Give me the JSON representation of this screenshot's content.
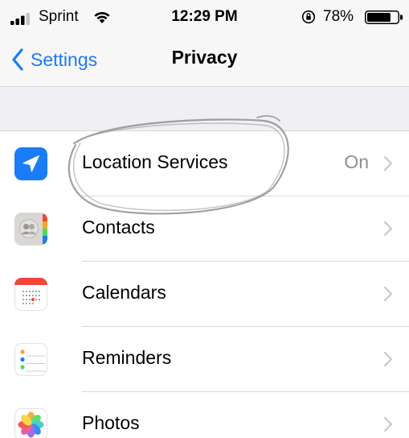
{
  "status_bar": {
    "carrier": "Sprint",
    "time": "12:29 PM",
    "battery_percent": "78%",
    "battery_level": 0.78
  },
  "nav": {
    "back_label": "Settings",
    "title": "Privacy"
  },
  "colors": {
    "accent": "#1a7cf6",
    "location_icon_bg": "#1a7cf6",
    "calendar_red": "#f0463c",
    "secondary_text": "#8e8e93",
    "grouped_bg": "#efeff4"
  },
  "list": {
    "items": [
      {
        "label": "Location Services",
        "value": "On",
        "icon": "location-arrow-icon"
      },
      {
        "label": "Contacts",
        "value": "",
        "icon": "contacts-icon"
      },
      {
        "label": "Calendars",
        "value": "",
        "icon": "calendar-icon"
      },
      {
        "label": "Reminders",
        "value": "",
        "icon": "reminders-icon"
      },
      {
        "label": "Photos",
        "value": "",
        "icon": "photos-icon"
      }
    ]
  }
}
